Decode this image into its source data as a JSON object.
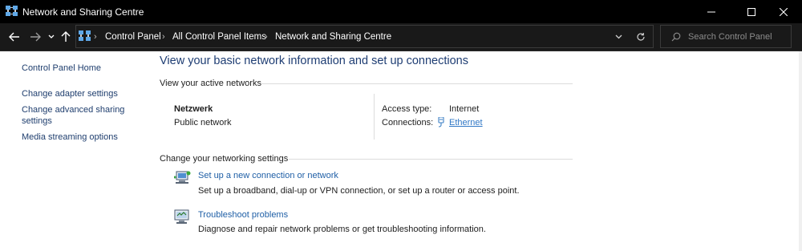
{
  "window": {
    "title": "Network and Sharing Centre"
  },
  "address_bar": {
    "breadcrumbs": [
      "Control Panel",
      "All Control Panel Items",
      "Network and Sharing Centre"
    ],
    "search_placeholder": "Search Control Panel"
  },
  "sidebar": {
    "items": [
      {
        "label": "Control Panel Home"
      },
      {
        "label": "Change adapter settings"
      },
      {
        "label": "Change advanced sharing\nsettings"
      },
      {
        "label": "Media streaming options"
      }
    ]
  },
  "main": {
    "title": "View your basic network information and set up connections",
    "active_networks_heading": "View your active networks",
    "network": {
      "name": "Netzwerk",
      "category": "Public network",
      "access_type_label": "Access type:",
      "access_type_value": "Internet",
      "connections_label": "Connections:",
      "connection_name": "Ethernet"
    },
    "change_settings_heading": "Change your networking settings",
    "tasks": [
      {
        "icon": "new-connection-icon",
        "link": "Set up a new connection or network",
        "description": "Set up a broadband, dial-up or VPN connection, or set up a router or access point."
      },
      {
        "icon": "troubleshoot-icon",
        "link": "Troubleshoot problems",
        "description": "Diagnose and repair network problems or get troubleshooting information."
      }
    ]
  },
  "colors": {
    "titlebar_bg": "#000000",
    "addressbar_bg": "#191919",
    "heading_blue": "#1e3d73",
    "link_blue": "#1f5fa6"
  }
}
